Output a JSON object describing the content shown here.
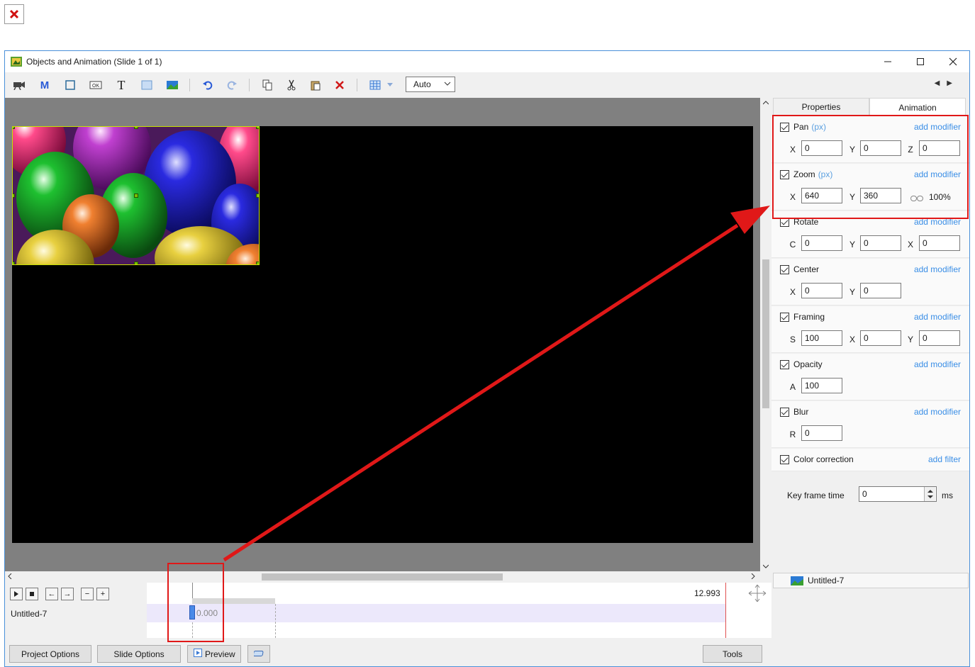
{
  "window": {
    "title": "Objects and Animation (Slide 1 of 1)"
  },
  "toolbar": {
    "zoom_value": "Auto"
  },
  "tabs": {
    "properties": "Properties",
    "animation": "Animation"
  },
  "sections": {
    "pan": {
      "label": "Pan",
      "unit": "(px)",
      "add": "add modifier",
      "f1_label": "X",
      "f1": "0",
      "f2_label": "Y",
      "f2": "0",
      "f3_label": "Z",
      "f3": "0"
    },
    "zoom": {
      "label": "Zoom",
      "unit": "(px)",
      "add": "add modifier",
      "f1_label": "X",
      "f1": "640",
      "f2_label": "Y",
      "f2": "360",
      "percent": "100%"
    },
    "rotate": {
      "label": "Rotate",
      "add": "add modifier",
      "f1_label": "C",
      "f1": "0",
      "f2_label": "Y",
      "f2": "0",
      "f3_label": "X",
      "f3": "0"
    },
    "center": {
      "label": "Center",
      "add": "add modifier",
      "f1_label": "X",
      "f1": "0",
      "f2_label": "Y",
      "f2": "0"
    },
    "framing": {
      "label": "Framing",
      "add": "add modifier",
      "f1_label": "S",
      "f1": "100",
      "f2_label": "X",
      "f2": "0",
      "f3_label": "Y",
      "f3": "0"
    },
    "opacity": {
      "label": "Opacity",
      "add": "add modifier",
      "f1_label": "A",
      "f1": "100"
    },
    "blur": {
      "label": "Blur",
      "add": "add modifier",
      "f1_label": "R",
      "f1": "0"
    },
    "color": {
      "label": "Color correction",
      "add": "add filter"
    }
  },
  "keyframe": {
    "label": "Key frame time",
    "value": "0",
    "unit": "ms"
  },
  "objects": {
    "item": "Untitled-7"
  },
  "timeline": {
    "track_name": "Untitled-7",
    "end_time": "12.993",
    "keyframe_time": "0.000"
  },
  "bottom": {
    "project_options": "Project Options",
    "slide_options": "Slide Options",
    "preview": "Preview",
    "tools": "Tools"
  },
  "colors": {
    "highlight": "#e01818",
    "link": "#3a8ee6",
    "window_border": "#4a90d9"
  }
}
